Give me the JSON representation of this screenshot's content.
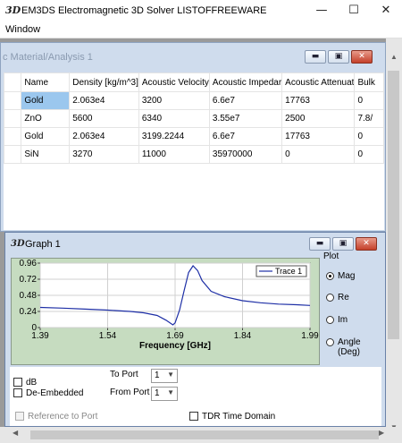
{
  "app": {
    "icon_text": "3D",
    "title": "EM3DS Electromagnetic 3D Solver    LISTOFFREEWARE",
    "minimize_label": "—",
    "maximize_label": "☐",
    "close_label": "✕"
  },
  "menu": {
    "items": [
      "Window"
    ]
  },
  "material_window": {
    "title": "c Material/Analysis 1",
    "columns": [
      "",
      "Name",
      "Density [kg/m^3]",
      "Acoustic Velocity",
      "Acoustic Impedar",
      "Acoustic Attenuat",
      "Bulk"
    ],
    "rows": [
      [
        "",
        "Gold",
        "2.063e4",
        "3200",
        "6.6e7",
        "17763",
        "0"
      ],
      [
        "",
        "ZnO",
        "5600",
        "6340",
        "3.55e7",
        "2500",
        "7.8/"
      ],
      [
        "",
        "Gold",
        "2.063e4",
        "3199.2244",
        "6.6e7",
        "17763",
        "0"
      ],
      [
        "",
        "SiN",
        "3270",
        "11000",
        "35970000",
        "0",
        "0"
      ]
    ]
  },
  "graph_window": {
    "icon_text": "3D",
    "title": "Graph 1",
    "plot_group_label": "Plot",
    "plot_options": [
      {
        "label": "Mag",
        "selected": true
      },
      {
        "label": "Re",
        "selected": false
      },
      {
        "label": "Im",
        "selected": false
      },
      {
        "label": "Angle (Deg)",
        "selected": false
      }
    ],
    "db_label": "dB",
    "de_embedded_label": "De-Embedded",
    "to_port_label": "To Port",
    "to_port_value": "1",
    "from_port_label": "From Port",
    "from_port_value": "1",
    "reference_to_port_label": "Reference to Port",
    "tdr_label": "TDR Time Domain"
  },
  "chart_data": {
    "type": "line",
    "title": "",
    "xlabel": "Frequency [GHz]",
    "ylabel": "",
    "xlim": [
      1.39,
      1.99
    ],
    "ylim": [
      0,
      0.96
    ],
    "xticks": [
      "1.39",
      "1.54",
      "1.69",
      "1.84",
      "1.99"
    ],
    "yticks": [
      "0",
      "0.24",
      "0.48",
      "0.72",
      "0.96"
    ],
    "grid": true,
    "legend": "top-right",
    "series": [
      {
        "name": "Trace 1",
        "color": "#1e2fa6",
        "x": [
          1.39,
          1.44,
          1.49,
          1.54,
          1.59,
          1.62,
          1.65,
          1.67,
          1.685,
          1.69,
          1.7,
          1.71,
          1.72,
          1.73,
          1.74,
          1.75,
          1.77,
          1.8,
          1.84,
          1.88,
          1.92,
          1.96,
          1.99
        ],
        "y": [
          0.3,
          0.29,
          0.275,
          0.26,
          0.24,
          0.22,
          0.18,
          0.11,
          0.04,
          0.07,
          0.26,
          0.55,
          0.82,
          0.92,
          0.85,
          0.7,
          0.54,
          0.46,
          0.4,
          0.37,
          0.35,
          0.34,
          0.33
        ]
      }
    ]
  }
}
